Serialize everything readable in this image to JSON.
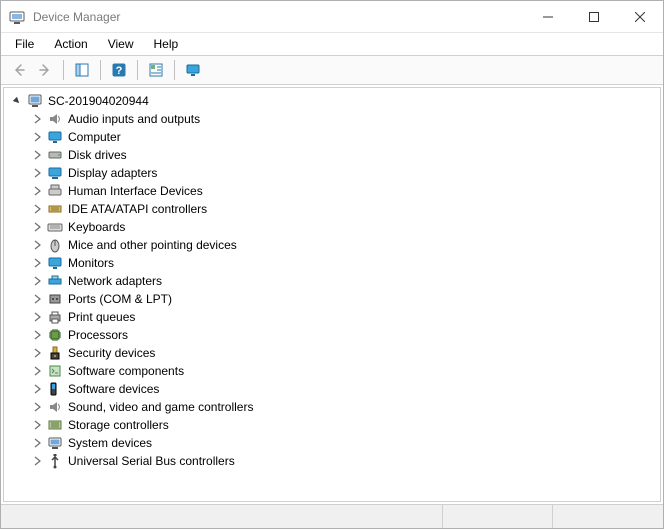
{
  "window": {
    "title": "Device Manager"
  },
  "menu": {
    "file": "File",
    "action": "Action",
    "view": "View",
    "help": "Help"
  },
  "tree": {
    "root_label": "SC-201904020944",
    "items": [
      {
        "label": "Audio inputs and outputs",
        "icon": "speaker-icon"
      },
      {
        "label": "Computer",
        "icon": "computer-icon"
      },
      {
        "label": "Disk drives",
        "icon": "disk-icon"
      },
      {
        "label": "Display adapters",
        "icon": "display-icon"
      },
      {
        "label": "Human Interface Devices",
        "icon": "hid-icon"
      },
      {
        "label": "IDE ATA/ATAPI controllers",
        "icon": "ide-icon"
      },
      {
        "label": "Keyboards",
        "icon": "keyboard-icon"
      },
      {
        "label": "Mice and other pointing devices",
        "icon": "mouse-icon"
      },
      {
        "label": "Monitors",
        "icon": "monitor-icon"
      },
      {
        "label": "Network adapters",
        "icon": "network-icon"
      },
      {
        "label": "Ports (COM & LPT)",
        "icon": "port-icon"
      },
      {
        "label": "Print queues",
        "icon": "printer-icon"
      },
      {
        "label": "Processors",
        "icon": "cpu-icon"
      },
      {
        "label": "Security devices",
        "icon": "security-icon"
      },
      {
        "label": "Software components",
        "icon": "swcomp-icon"
      },
      {
        "label": "Software devices",
        "icon": "swdev-icon"
      },
      {
        "label": "Sound, video and game controllers",
        "icon": "sound-icon"
      },
      {
        "label": "Storage controllers",
        "icon": "storage-icon"
      },
      {
        "label": "System devices",
        "icon": "system-icon"
      },
      {
        "label": "Universal Serial Bus controllers",
        "icon": "usb-icon"
      }
    ]
  }
}
